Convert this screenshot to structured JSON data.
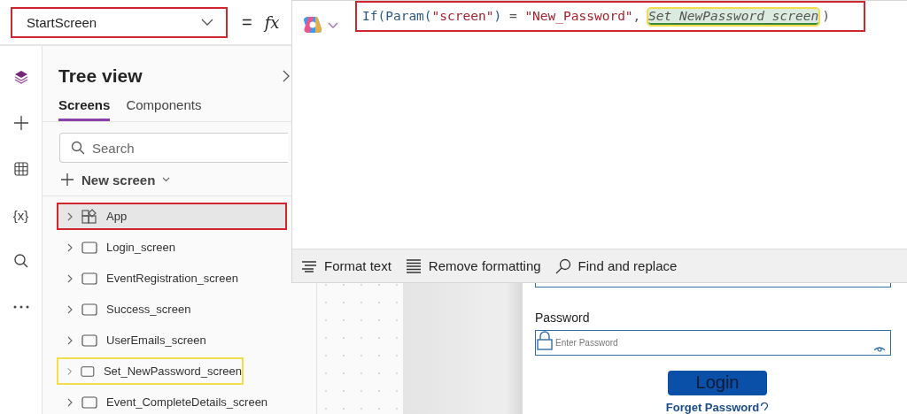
{
  "property_dropdown": {
    "value": "StartScreen",
    "annotated": true
  },
  "formula_bar": {
    "equals": "=",
    "fx": "fx"
  },
  "formula_editor": {
    "annotated": true,
    "tokens": [
      {
        "kind": "func",
        "text": "If("
      },
      {
        "kind": "func",
        "text": "Param("
      },
      {
        "kind": "string",
        "text": "\"screen\""
      },
      {
        "kind": "func",
        "text": ")"
      },
      {
        "kind": "op",
        "text": " = "
      },
      {
        "kind": "string",
        "text": "\"New_Password\""
      },
      {
        "kind": "op",
        "text": ", "
      },
      {
        "kind": "ident",
        "text": "Set_NewPassword_screen"
      },
      {
        "kind": "op",
        "text": ")"
      }
    ],
    "toolbar": [
      {
        "kind": "format",
        "label": "Format text"
      },
      {
        "kind": "remove",
        "label": "Remove formatting"
      },
      {
        "kind": "find",
        "label": "Find and replace"
      }
    ]
  },
  "rail": [
    {
      "kind": "layers",
      "selected": true
    },
    {
      "kind": "plus"
    },
    {
      "kind": "table"
    },
    {
      "kind": "variables",
      "text": "{x}"
    },
    {
      "kind": "search"
    },
    {
      "kind": "more"
    }
  ],
  "tree_view": {
    "title": "Tree view",
    "tabs": [
      {
        "label": "Screens",
        "selected": true
      },
      {
        "label": "Components",
        "selected": false
      }
    ],
    "search": {
      "placeholder": "Search"
    },
    "new_screen": "New screen",
    "items": [
      {
        "kind": "app",
        "label": "App",
        "selected": true,
        "color": "#d0262d"
      },
      {
        "kind": "screen",
        "label": "Login_screen",
        "selected": false
      },
      {
        "kind": "screen",
        "label": "EventRegistration_screen",
        "selected": false
      },
      {
        "kind": "screen",
        "label": "Success_screen",
        "selected": false
      },
      {
        "kind": "screen",
        "label": "UserEmails_screen",
        "selected": false
      },
      {
        "kind": "screen",
        "label": "Set_NewPassword_screen",
        "selected": false,
        "color": "#f0dd50"
      },
      {
        "kind": "screen",
        "label": "Event_CompleteDetails_screen",
        "selected": false
      }
    ]
  },
  "app_preview": {
    "password_label": "Password",
    "password_placeholder": "Enter Password",
    "login_button": "Login",
    "forgot_link": "Forget Password"
  }
}
